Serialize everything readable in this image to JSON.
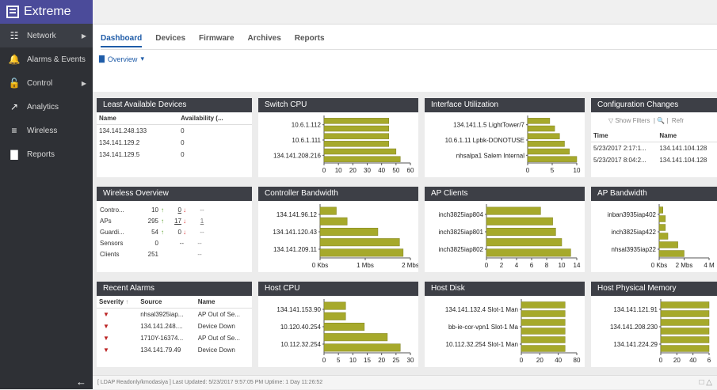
{
  "app": {
    "brand": "Extreme"
  },
  "sidebar": {
    "items": [
      {
        "label": "Network",
        "icon": "network-icon",
        "has_arrow": true
      },
      {
        "label": "Alarms & Events",
        "icon": "bell-icon"
      },
      {
        "label": "Control",
        "icon": "lock-icon",
        "has_arrow": true
      },
      {
        "label": "Analytics",
        "icon": "chart-line-icon"
      },
      {
        "label": "Wireless",
        "icon": "wifi-icon"
      },
      {
        "label": "Reports",
        "icon": "bar-chart-icon"
      }
    ]
  },
  "tabs": [
    {
      "label": "Dashboard",
      "active": true
    },
    {
      "label": "Devices"
    },
    {
      "label": "Firmware"
    },
    {
      "label": "Archives"
    },
    {
      "label": "Reports"
    }
  ],
  "view_select": {
    "label": "Overview"
  },
  "panels": {
    "least_available": {
      "title": "Least Available Devices",
      "columns": [
        "Name",
        "Availability (..."
      ],
      "rows": [
        [
          "134.141.248.133",
          "0"
        ],
        [
          "134.141.129.2",
          "0"
        ],
        [
          "134.141.129.5",
          "0"
        ]
      ]
    },
    "wireless_overview": {
      "title": "Wireless Overview",
      "rows": [
        {
          "name": "Contro...",
          "count": "10",
          "down": "0",
          "other": "--"
        },
        {
          "name": "APs",
          "count": "295",
          "down": "17",
          "other": "1"
        },
        {
          "name": "Guardi...",
          "count": "54",
          "down": "0",
          "other": "--"
        },
        {
          "name": "Sensors",
          "count": "0",
          "down": "--",
          "other": "--"
        },
        {
          "name": "Clients",
          "count": "251",
          "down": "",
          "other": "--"
        }
      ]
    },
    "recent_alarms": {
      "title": "Recent Alarms",
      "columns": [
        "Severity",
        "Source",
        "Name"
      ],
      "rows": [
        [
          "nhsal3925iap...",
          "AP Out of Se..."
        ],
        [
          "134.141.248....",
          "Device Down"
        ],
        [
          "1710Y-16374...",
          "AP Out of Se..."
        ],
        [
          "134.141.79.49",
          "Device Down"
        ]
      ]
    },
    "config_changes": {
      "title": "Configuration Changes",
      "show_filters": "Show Filters",
      "refresh": "Refr",
      "columns": [
        "Time",
        "Name"
      ],
      "rows": [
        [
          "5/23/2017 2:17:1...",
          "134.141.104.128"
        ],
        [
          "5/23/2017 8:04:2...",
          "134.141.104.128"
        ]
      ]
    }
  },
  "chart_data": [
    {
      "id": "switch_cpu",
      "type": "bar",
      "title": "Switch CPU",
      "orientation": "horizontal",
      "categories": [
        "10.6.1.112",
        "",
        "10.6.1.111",
        "",
        "134.141.208.216",
        ""
      ],
      "labels": [
        "10.6.1.112",
        "10.6.1.111",
        "134.141.208.216"
      ],
      "values": [
        45,
        45,
        45,
        45,
        50,
        53
      ],
      "ticks": [
        "0",
        "10",
        "20",
        "30",
        "40",
        "50",
        "60"
      ],
      "xlim": [
        0,
        60
      ]
    },
    {
      "id": "interface_util",
      "type": "bar",
      "title": "Interface Utilization",
      "orientation": "horizontal",
      "labels": [
        "134.141.1.5 LightTower/7",
        "10.6.1.11 Lpbk-DONOTUSE",
        "nhsalpa1 Salem Internal"
      ],
      "values": [
        4.5,
        5.5,
        6.5,
        7.5,
        8.5,
        10
      ],
      "ticks": [
        "0",
        "5",
        "10"
      ],
      "xlim": [
        0,
        10
      ]
    },
    {
      "id": "config_chart_placeholder",
      "type": "none"
    },
    {
      "id": "controller_bw",
      "type": "bar",
      "title": "Controller Bandwidth",
      "orientation": "horizontal",
      "labels": [
        "134.141.96.12",
        "134.141.120.43",
        "134.141.209.11"
      ],
      "values": [
        0.45,
        0.75,
        1.6,
        2.2,
        2.3
      ],
      "ticks": [
        "0 Kbs",
        "1 Mbs",
        "2 Mbs"
      ],
      "xlim": [
        0,
        2.5
      ]
    },
    {
      "id": "ap_clients",
      "type": "bar",
      "title": "AP Clients",
      "orientation": "horizontal",
      "labels": [
        "inch3825iap804",
        "inch3825iap801",
        "inch3825iap802"
      ],
      "values": [
        9,
        11,
        11.5,
        12.5,
        14
      ],
      "ticks": [
        "0",
        "2",
        "4",
        "6",
        "8",
        "10",
        "14"
      ],
      "xlim": [
        0,
        15
      ]
    },
    {
      "id": "ap_bandwidth",
      "type": "bar",
      "title": "AP Bandwidth",
      "orientation": "horizontal",
      "labels": [
        "inban3935iap402",
        "inch3825iap422",
        "nhsal3935iap22"
      ],
      "values": [
        0.3,
        0.5,
        0.5,
        0.7,
        1.5,
        2.0
      ],
      "ticks": [
        "0 Kbs",
        "2 Mbs",
        "4 M"
      ],
      "xlim": [
        0,
        4
      ]
    },
    {
      "id": "host_cpu",
      "type": "bar",
      "title": "Host CPU",
      "orientation": "horizontal",
      "labels": [
        "134.141.153.90",
        "10.120.40.254",
        "10.112.32.254"
      ],
      "values": [
        7.5,
        7.5,
        14,
        22,
        26.5
      ],
      "ticks": [
        "0",
        "5",
        "10",
        "15",
        "20",
        "25",
        "30"
      ],
      "xlim": [
        0,
        30
      ]
    },
    {
      "id": "host_disk",
      "type": "bar",
      "title": "Host Disk",
      "orientation": "horizontal",
      "labels": [
        "134.141.132.4 Slot-1 Man",
        "bb-ie-cor-vpn1 Slot-1 Ma",
        "10.112.32.254 Slot-1 Man"
      ],
      "values": [
        75,
        75,
        75,
        75,
        75,
        75
      ],
      "ticks": [
        "0",
        "20",
        "40",
        "80"
      ],
      "xlim": [
        0,
        95
      ]
    },
    {
      "id": "host_memory",
      "type": "bar",
      "title": "Host Physical Memory",
      "orientation": "horizontal",
      "labels": [
        "134.141.121.91",
        "134.141.208.230",
        "134.141.224.29"
      ],
      "values": [
        60,
        60,
        60,
        60,
        60,
        60
      ],
      "ticks": [
        "0",
        "20",
        "40",
        "6"
      ],
      "xlim": [
        0,
        60
      ]
    }
  ],
  "status_bar": {
    "text": "[ LDAP Readonly/kmodasiya ]  Last Updated: 5/23/2017 9:57:05 PM  Uptime: 1 Day 11:26:52"
  },
  "colors": {
    "bar": "#a6a92b",
    "bar_edge": "#7f8220",
    "header": "#3d3f46",
    "accent": "#1f5ca8",
    "sidebar": "#2e3035"
  }
}
